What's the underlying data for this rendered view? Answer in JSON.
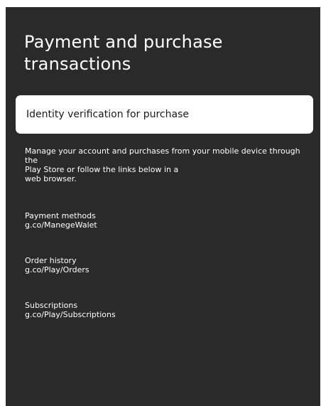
{
  "page": {
    "title": "Payment and purchase\n transactions"
  },
  "selected_item": {
    "label": "Identity verification for purchase"
  },
  "description": "Manage your account and purchases from your mobile device through the\nPlay Store or follow the links below in a\nweb browser.",
  "links": [
    {
      "label": "Payment methods",
      "url": "g.co/ManegeWalet"
    },
    {
      "label": "Order history",
      "url": "g.co/Play/Orders"
    },
    {
      "label": "Subscriptions",
      "url": "g.co/Play/Subscriptions"
    }
  ],
  "colors": {
    "panel_background": "#2a2a2a",
    "text": "#ffffff",
    "selected_item_background": "#ffffff",
    "selected_item_text": "#1a1a1a"
  }
}
